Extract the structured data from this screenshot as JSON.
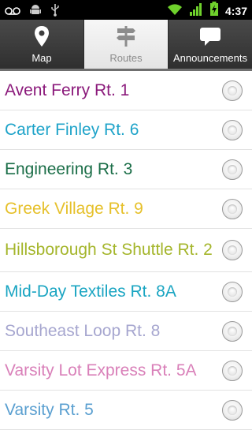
{
  "status_bar": {
    "time": "4:37",
    "icons": [
      "voicemail-icon",
      "android-debug-icon",
      "usb-icon",
      "wifi-icon",
      "signal-icon",
      "battery-icon"
    ]
  },
  "tabs": [
    {
      "label": "Map",
      "icon": "map-pin-icon",
      "active": false
    },
    {
      "label": "Routes",
      "icon": "signpost-icon",
      "active": true
    },
    {
      "label": "Announcements",
      "icon": "speech-bubble-icon",
      "active": false
    }
  ],
  "routes": [
    {
      "name": "Avent Ferry Rt. 1",
      "color": "#8b1a7b"
    },
    {
      "name": "Carter Finley Rt. 6",
      "color": "#1ea3c9"
    },
    {
      "name": "Engineering Rt. 3",
      "color": "#1b6e48"
    },
    {
      "name": "Greek Village Rt. 9",
      "color": "#e6c02a"
    },
    {
      "name": "Hillsborough St Shuttle Rt. 2",
      "color": "#a4b52a"
    },
    {
      "name": "Mid-Day Textiles Rt. 8A",
      "color": "#1aa5c2"
    },
    {
      "name": "Southeast Loop Rt. 8",
      "color": "#a6a6cf"
    },
    {
      "name": "Varsity Lot Express Rt. 5A",
      "color": "#d980b9"
    },
    {
      "name": "Varsity Rt. 5",
      "color": "#5a9fd0"
    }
  ]
}
